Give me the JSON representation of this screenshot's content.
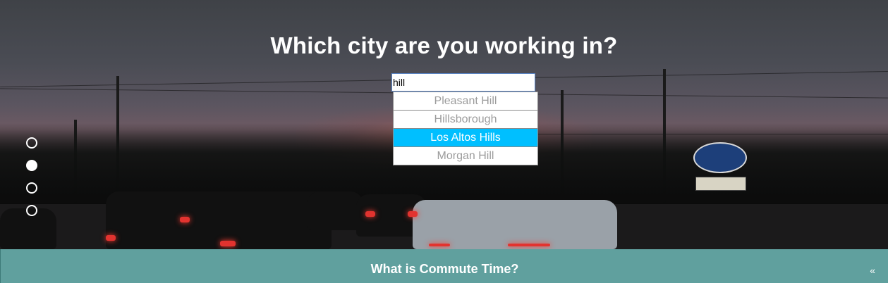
{
  "question": "Which city are you working in?",
  "search": {
    "value": "hill"
  },
  "suggestions": [
    {
      "label": "Pleasant Hill"
    },
    {
      "label": "Hillsborough"
    },
    {
      "label": "Los Altos Hills",
      "active": true
    },
    {
      "label": "Morgan Hill"
    }
  ],
  "pager": {
    "count": 4,
    "current": 2
  },
  "bottom_bar": {
    "title": "What is Commute Time?",
    "collapse_label": "«"
  },
  "colors": {
    "active_suggestion": "#00bfff",
    "bottom_bar": "#60a09e"
  }
}
